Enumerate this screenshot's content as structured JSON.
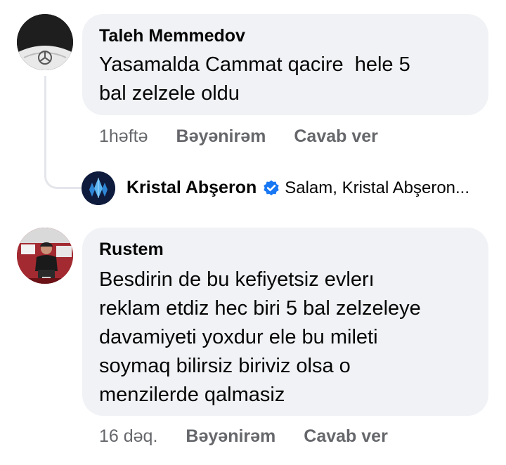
{
  "comments": [
    {
      "author": "Taleh Memmedov",
      "text": "Yasamalda Cammat qacire  hele 5\nbal zelzele oldu",
      "time": "1həftə",
      "like_label": "Bəyənirəm",
      "reply_label": "Cavab ver",
      "avatar_icon": "dark-car-logo-avatar"
    },
    {
      "author": "Rustem",
      "text": "Besdirin de bu kefiyetsiz evlerı\nreklam etdiz hec biri 5 bal zelzeleye\ndavamiyeti yoxdur ele bu mileti\nsoymaq bilirsiz biriviz olsa o\nmenzilerde qalmasiz",
      "time": "16 dəq.",
      "like_label": "Bəyənirəm",
      "reply_label": "Cavab ver",
      "avatar_icon": "person-photo-avatar"
    }
  ],
  "reply_preview": {
    "author": "Kristal Abşeron",
    "text": "Salam, Kristal Abşeron...",
    "verified_icon": "verified-badge-icon",
    "avatar_icon": "kristal-crystal-logo-icon"
  },
  "colors": {
    "bubble": "#f0f2f5",
    "text": "#050505",
    "secondary": "#65676b",
    "verified": "#1877f2",
    "kristal_bg": "#0f1b3d"
  }
}
